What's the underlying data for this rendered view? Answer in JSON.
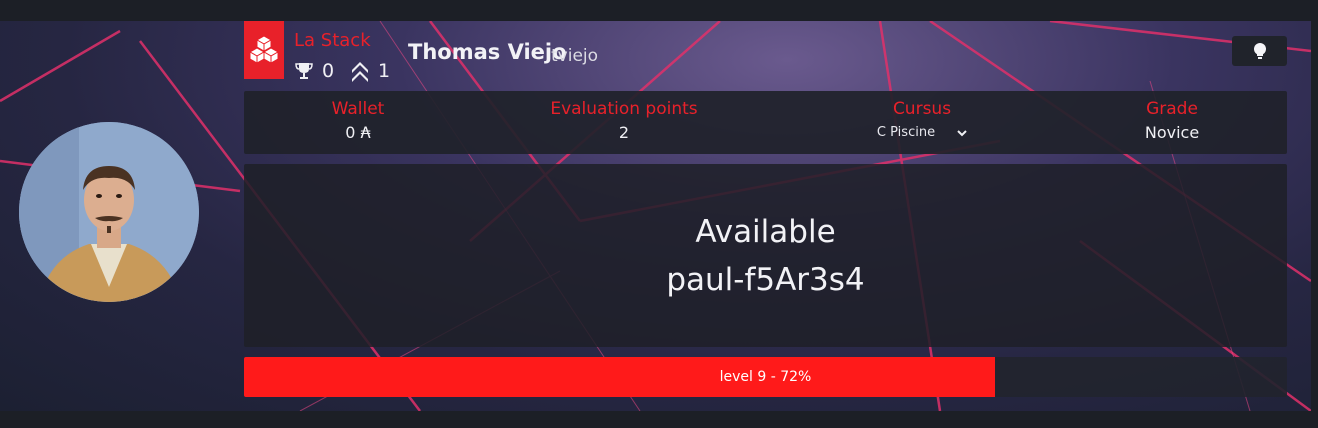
{
  "profile": {
    "full_name": "Thomas Viejo",
    "login": "tviejo",
    "avatar_icon": "user-portrait"
  },
  "coalition": {
    "name": "La Stack",
    "color": "#e8212a",
    "icon": "stacked-cubes-icon",
    "trophies": "0",
    "rank": "1"
  },
  "infobar": {
    "wallet": {
      "label": "Wallet",
      "value": "0 ₳"
    },
    "evaluation_points": {
      "label": "Evaluation points",
      "value": "2"
    },
    "cursus": {
      "label": "Cursus",
      "value": "C Piscine"
    },
    "grade": {
      "label": "Grade",
      "value": "Novice"
    }
  },
  "location": {
    "status": "Available",
    "host": "paul-f5Ar3s4"
  },
  "level": {
    "label": "level 9 - 72%",
    "progress": 0.72,
    "fill_color": "#ff1a1a"
  },
  "theme_toggle": {
    "icon": "lightbulb-icon"
  }
}
